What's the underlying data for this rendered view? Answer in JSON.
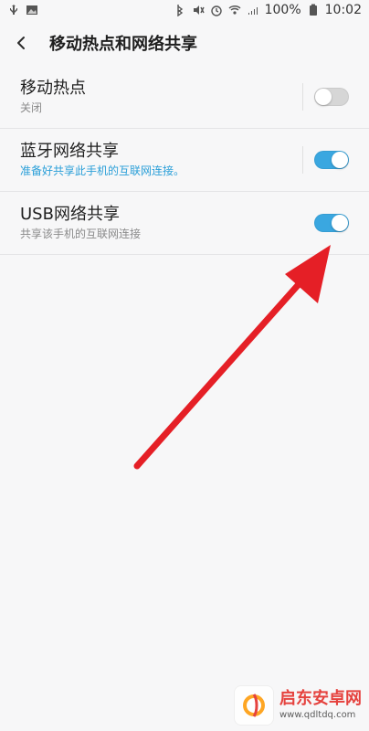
{
  "status_bar": {
    "left_icons": [
      "usb-icon",
      "image-icon"
    ],
    "right_icons": [
      "bluetooth-icon",
      "mute-icon",
      "alarm-icon",
      "wifi-icon",
      "signal-icon",
      "battery-icon"
    ],
    "battery_text": "100%",
    "time": "10:02"
  },
  "app_bar": {
    "title": "移动热点和网络共享",
    "back_icon": "chevron-left-icon"
  },
  "settings": [
    {
      "title": "移动热点",
      "subtitle": "关闭",
      "enabled": false,
      "accent": false
    },
    {
      "title": "蓝牙网络共享",
      "subtitle": "准备好共享此手机的互联网连接。",
      "enabled": true,
      "accent": true
    },
    {
      "title": "USB网络共享",
      "subtitle": "共享该手机的互联网连接",
      "enabled": true,
      "accent": false
    }
  ],
  "colors": {
    "toggle_on": "#3aa7e0",
    "toggle_off": "#d6d6d6",
    "accent_text": "#2a9fd8",
    "annotation_red": "#e51f26",
    "background": "#f7f7f8"
  },
  "watermark": {
    "brand": "启东安卓网",
    "url": "www.qdltdq.com"
  }
}
